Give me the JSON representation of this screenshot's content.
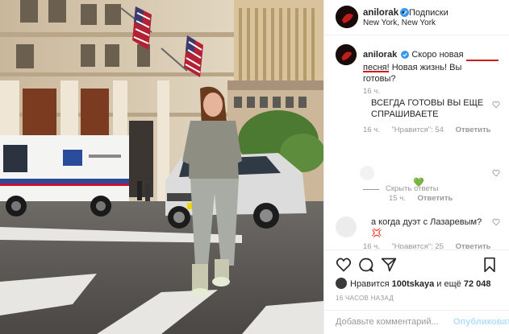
{
  "header": {
    "username": "anilorak",
    "separator": "•",
    "follow_label": "Подписки",
    "location": "New York, New York"
  },
  "caption": {
    "username": "anilorak",
    "text_part1": "Скоро новая песня! ",
    "text_highlight": "Новая жизнь!",
    "text_part2": " Вы готовы?",
    "time": "16 ч."
  },
  "comments": [
    {
      "text": "ВСЕГДА ГОТОВЫ ВЫ ЕЩЕ СПРАШИВАЕТЕ",
      "time": "16 ч.",
      "likes": "\"Нравится\": 54",
      "reply": "Ответить"
    },
    {
      "hide_replies": "Скрыть ответы"
    },
    {
      "text": "💚",
      "time": "15 ч.",
      "reply": "Ответить"
    },
    {
      "text": "а когда дуэт с Лазаревым?💢",
      "time": "16 ч.",
      "likes": "\"Нравится\": 25",
      "reply": "Ответить"
    }
  ],
  "likes": {
    "prefix": "Нравится ",
    "user": "100tskaya",
    "middle": " и ещё ",
    "count": "72 048"
  },
  "time_ago": "16 ЧАСОВ НАЗАД",
  "add_comment": {
    "placeholder": "Добавьте комментарий...",
    "publish_label": "Опубликовать"
  },
  "colors": {
    "verified": "#3897f0",
    "highlight_underline": "#d11b1b",
    "publish": "#b2dffc",
    "meta_text": "#999999"
  }
}
